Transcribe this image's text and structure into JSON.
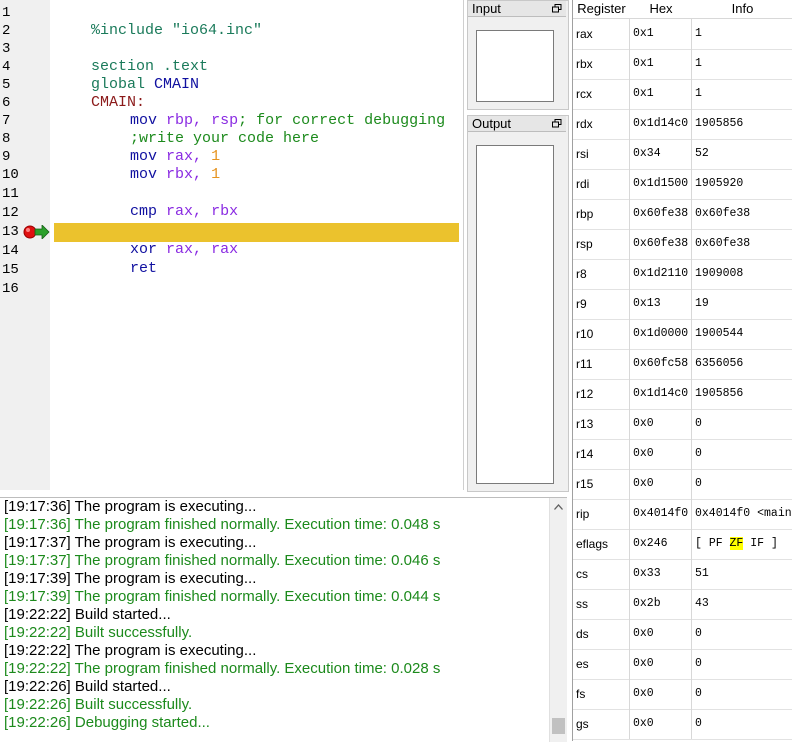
{
  "editor": {
    "line_numbers": [
      "1",
      "2",
      "3",
      "4",
      "5",
      "6",
      "7",
      "8",
      "9",
      "10",
      "11",
      "12",
      "13",
      "14",
      "15",
      "16"
    ],
    "lines": {
      "l1": {
        "a": "%include \"io64.inc\""
      },
      "l3": {
        "a": "section .text"
      },
      "l4": {
        "a": "global ",
        "b": "CMAIN"
      },
      "l5": {
        "a": "CMAIN:"
      },
      "l6": {
        "a": "mov ",
        "b": "rbp",
        "c": ", ",
        "d": "rsp",
        "e": "; for correct debugging"
      },
      "l7": {
        "a": ";write your code here"
      },
      "l8": {
        "a": "mov ",
        "b": "rax",
        "c": ", ",
        "d": "1"
      },
      "l9": {
        "a": "mov ",
        "b": "rbx",
        "c": ", ",
        "d": "1"
      },
      "l11": {
        "a": "cmp ",
        "b": "rax",
        "c": ", ",
        "d": "rbx"
      },
      "l13": {
        "a": "xor ",
        "b": "rax",
        "c": ", ",
        "d": "rax"
      },
      "l14": {
        "a": "ret"
      }
    },
    "current_line": 13,
    "breakpoint_line": 13,
    "highlight_color": "#ebc22d"
  },
  "panes": {
    "input_title": "Input",
    "output_title": "Output"
  },
  "console": {
    "lines": [
      {
        "text": "[19:17:36] The program is executing...",
        "status": "plain"
      },
      {
        "text": "[19:17:36] The program finished normally. Execution time: 0.048 s",
        "status": "ok"
      },
      {
        "text": "[19:17:37] The program is executing...",
        "status": "plain"
      },
      {
        "text": "[19:17:37] The program finished normally. Execution time: 0.046 s",
        "status": "ok"
      },
      {
        "text": "[19:17:39] The program is executing...",
        "status": "plain"
      },
      {
        "text": "[19:17:39] The program finished normally. Execution time: 0.044 s",
        "status": "ok"
      },
      {
        "text": "[19:22:22] Build started...",
        "status": "plain"
      },
      {
        "text": "[19:22:22] Built successfully.",
        "status": "ok"
      },
      {
        "text": "[19:22:22] The program is executing...",
        "status": "plain"
      },
      {
        "text": "[19:22:22] The program finished normally. Execution time: 0.028 s",
        "status": "ok"
      },
      {
        "text": "[19:22:26] Build started...",
        "status": "plain"
      },
      {
        "text": "[19:22:26] Built successfully.",
        "status": "ok"
      },
      {
        "text": "[19:22:26] Debugging started...",
        "status": "ok"
      }
    ]
  },
  "registers": {
    "headers": {
      "name": "Register",
      "hex": "Hex",
      "info": "Info"
    },
    "rows": [
      {
        "name": "rax",
        "hex": "0x1",
        "info": "1"
      },
      {
        "name": "rbx",
        "hex": "0x1",
        "info": "1"
      },
      {
        "name": "rcx",
        "hex": "0x1",
        "info": "1"
      },
      {
        "name": "rdx",
        "hex": "0x1d14c0",
        "info": "1905856"
      },
      {
        "name": "rsi",
        "hex": "0x34",
        "info": "52"
      },
      {
        "name": "rdi",
        "hex": "0x1d1500",
        "info": "1905920"
      },
      {
        "name": "rbp",
        "hex": "0x60fe38",
        "info": "0x60fe38"
      },
      {
        "name": "rsp",
        "hex": "0x60fe38",
        "info": "0x60fe38"
      },
      {
        "name": "r8",
        "hex": "0x1d2110",
        "info": "1909008"
      },
      {
        "name": "r9",
        "hex": "0x13",
        "info": "19"
      },
      {
        "name": "r10",
        "hex": "0x1d0000",
        "info": "1900544"
      },
      {
        "name": "r11",
        "hex": "0x60fc58",
        "info": "6356056"
      },
      {
        "name": "r12",
        "hex": "0x1d14c0",
        "info": "1905856"
      },
      {
        "name": "r13",
        "hex": "0x0",
        "info": "0"
      },
      {
        "name": "r14",
        "hex": "0x0",
        "info": "0"
      },
      {
        "name": "r15",
        "hex": "0x0",
        "info": "0"
      },
      {
        "name": "rip",
        "hex": "0x4014f0",
        "info": "0x4014f0 <main"
      },
      {
        "name": "eflags",
        "hex": "0x246",
        "info": "",
        "flags": {
          "open": "[ ",
          "pf": "PF ",
          "zf": "ZF",
          "if": " IF ]"
        }
      },
      {
        "name": "cs",
        "hex": "0x33",
        "info": "51"
      },
      {
        "name": "ss",
        "hex": "0x2b",
        "info": "43"
      },
      {
        "name": "ds",
        "hex": "0x0",
        "info": "0"
      },
      {
        "name": "es",
        "hex": "0x0",
        "info": "0"
      },
      {
        "name": "fs",
        "hex": "0x0",
        "info": "0"
      },
      {
        "name": "gs",
        "hex": "0x0",
        "info": "0"
      }
    ]
  }
}
